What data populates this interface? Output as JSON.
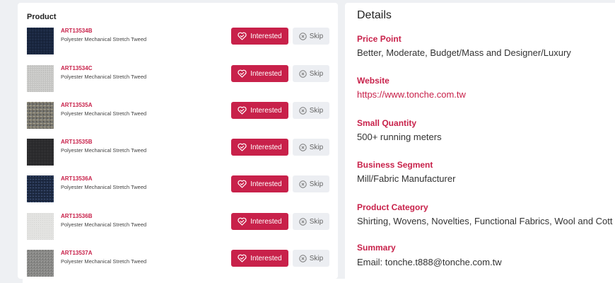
{
  "product_list": {
    "header": "Product",
    "interested_label": "Interested",
    "skip_label": "Skip",
    "items": [
      {
        "code": "ART13534B",
        "description": "Polyester Mechanical Stretch Tweed",
        "swatch": "navy-tweed"
      },
      {
        "code": "ART13534C",
        "description": "Polyester Mechanical Stretch Tweed",
        "swatch": "light-grey"
      },
      {
        "code": "ART13535A",
        "description": "Polyester Mechanical Stretch Tweed",
        "swatch": "multicolor-tweed"
      },
      {
        "code": "ART13535B",
        "description": "Polyester Mechanical Stretch Tweed",
        "swatch": "charcoal"
      },
      {
        "code": "ART13536A",
        "description": "Polyester Mechanical Stretch Tweed",
        "swatch": "blue-tweed"
      },
      {
        "code": "ART13536B",
        "description": "Polyester Mechanical Stretch Tweed",
        "swatch": "white"
      },
      {
        "code": "ART13537A",
        "description": "Polyester Mechanical Stretch Tweed",
        "swatch": "grey-tweed"
      }
    ]
  },
  "details": {
    "title": "Details",
    "fields": [
      {
        "label": "Price Point",
        "value": "Better, Moderate, Budget/Mass and Designer/Luxury"
      },
      {
        "label": "Website",
        "value": "https://www.tonche.com.tw"
      },
      {
        "label": "Small Quantity",
        "value": "500+ running meters"
      },
      {
        "label": "Business Segment",
        "value": "Mill/Fabric Manufacturer"
      },
      {
        "label": "Product Category",
        "value": "Shirting, Wovens, Novelties, Functional Fabrics, Wool and Cott"
      },
      {
        "label": "Summary",
        "value": "Email: tonche.t888@tonche.com.tw"
      }
    ]
  },
  "colors": {
    "accent": "#c8214a",
    "skip_bg": "#eceef2",
    "page_bg": "#eef0f3"
  },
  "icons": {
    "interested": "heart-handshake-icon",
    "skip": "circle-x-icon"
  }
}
